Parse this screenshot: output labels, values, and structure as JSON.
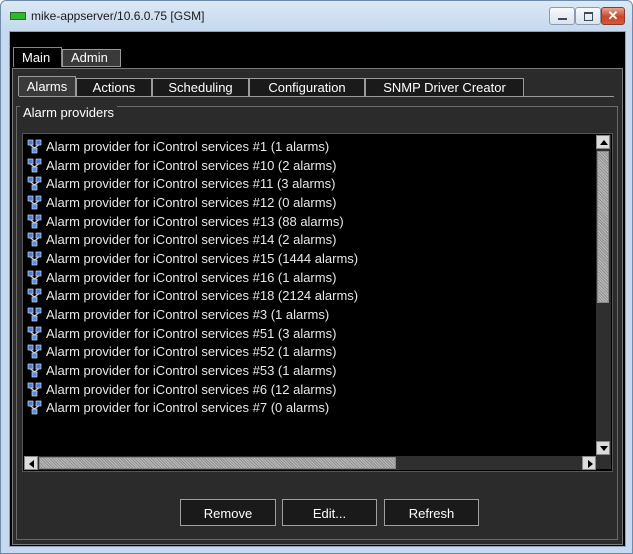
{
  "window": {
    "title": "mike-appserver/10.6.0.75 [GSM]",
    "controls": {
      "minimize": "",
      "maximize": "",
      "close": "✕"
    }
  },
  "main_tabs": [
    {
      "label": "Main",
      "selected": true
    },
    {
      "label": "Admin",
      "selected": false
    }
  ],
  "sub_tabs": [
    {
      "label": "Alarms",
      "selected": true
    },
    {
      "label": "Actions",
      "selected": false
    },
    {
      "label": "Scheduling",
      "selected": false
    },
    {
      "label": "Configuration",
      "selected": false
    },
    {
      "label": "SNMP Driver Creator",
      "selected": false
    }
  ],
  "group": {
    "title": "Alarm providers"
  },
  "providers": [
    "Alarm provider for iControl services #1 (1 alarms)",
    "Alarm provider for iControl services #10 (2 alarms)",
    "Alarm provider for iControl services #11 (3 alarms)",
    "Alarm provider for iControl services #12 (0 alarms)",
    "Alarm provider for iControl services #13 (88 alarms)",
    "Alarm provider for iControl services #14 (2 alarms)",
    "Alarm provider for iControl services #15 (1444 alarms)",
    "Alarm provider for iControl services #16 (1 alarms)",
    "Alarm provider for iControl services #18 (2124 alarms)",
    "Alarm provider for iControl services #3 (1 alarms)",
    "Alarm provider for iControl services #51 (3 alarms)",
    "Alarm provider for iControl services #52 (1 alarms)",
    "Alarm provider for iControl services #53 (1 alarms)",
    "Alarm provider for iControl services #6 (12 alarms)",
    "Alarm provider for iControl services #7 (0 alarms)"
  ],
  "buttons": {
    "remove": "Remove",
    "edit": "Edit...",
    "refresh": "Refresh"
  },
  "colors": {
    "title_icon": "#2fb82f",
    "close_button": "#c9452a",
    "panel_background": "#2b2b2b",
    "list_background": "#000000"
  },
  "icons": {
    "list_item": "network-node-icon"
  }
}
